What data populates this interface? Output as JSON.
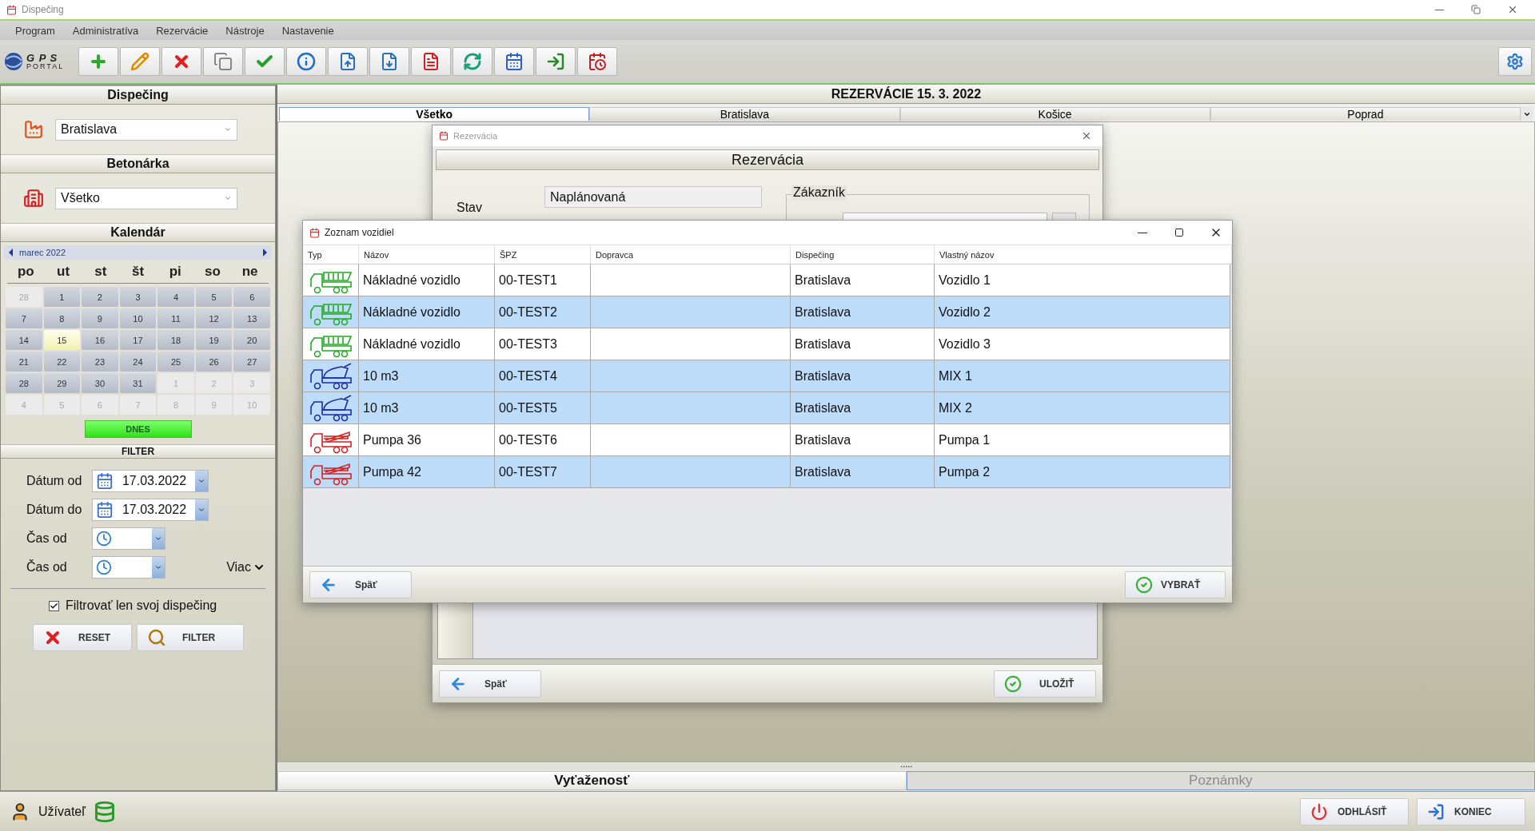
{
  "window": {
    "title": "Dispečing"
  },
  "menu": [
    "Program",
    "Administratíva",
    "Rezervácie",
    "Nástroje",
    "Nastavenie"
  ],
  "logo": {
    "top": "G P S",
    "bottom": "PORTAL"
  },
  "toolbar": [
    {
      "kind": "add"
    },
    {
      "kind": "edit"
    },
    {
      "kind": "delete"
    },
    {
      "kind": "copy"
    },
    {
      "kind": "confirm"
    },
    {
      "kind": "info"
    },
    {
      "kind": "import"
    },
    {
      "kind": "export"
    },
    {
      "kind": "pdf"
    },
    {
      "kind": "refresh"
    },
    {
      "kind": "calendar"
    },
    {
      "kind": "exit"
    },
    {
      "kind": "schedule"
    }
  ],
  "sidebar": {
    "dispatch": {
      "title": "Dispečing",
      "value": "Bratislava"
    },
    "plant": {
      "title": "Betonárka",
      "value": "Všetko"
    },
    "calendar": {
      "title": "Kalendár",
      "month": "marec 2022",
      "weekdays": [
        "po",
        "ut",
        "st",
        "št",
        "pi",
        "so",
        "ne"
      ],
      "today_button": "DNES",
      "days": [
        {
          "day": "28",
          "outside": true,
          "today": false
        },
        {
          "day": "1",
          "outside": false,
          "today": false
        },
        {
          "day": "2",
          "outside": false,
          "today": false
        },
        {
          "day": "3",
          "outside": false,
          "today": false
        },
        {
          "day": "4",
          "outside": false,
          "today": false
        },
        {
          "day": "5",
          "outside": false,
          "today": false
        },
        {
          "day": "6",
          "outside": false,
          "today": false
        },
        {
          "day": "7",
          "outside": false,
          "today": false
        },
        {
          "day": "8",
          "outside": false,
          "today": false
        },
        {
          "day": "9",
          "outside": false,
          "today": false
        },
        {
          "day": "10",
          "outside": false,
          "today": false
        },
        {
          "day": "11",
          "outside": false,
          "today": false
        },
        {
          "day": "12",
          "outside": false,
          "today": false
        },
        {
          "day": "13",
          "outside": false,
          "today": false
        },
        {
          "day": "14",
          "outside": false,
          "today": false
        },
        {
          "day": "15",
          "outside": false,
          "today": true
        },
        {
          "day": "16",
          "outside": false,
          "today": false
        },
        {
          "day": "17",
          "outside": false,
          "today": false
        },
        {
          "day": "18",
          "outside": false,
          "today": false
        },
        {
          "day": "19",
          "outside": false,
          "today": false
        },
        {
          "day": "20",
          "outside": false,
          "today": false
        },
        {
          "day": "21",
          "outside": false,
          "today": false
        },
        {
          "day": "22",
          "outside": false,
          "today": false
        },
        {
          "day": "23",
          "outside": false,
          "today": false
        },
        {
          "day": "24",
          "outside": false,
          "today": false
        },
        {
          "day": "25",
          "outside": false,
          "today": false
        },
        {
          "day": "26",
          "outside": false,
          "today": false
        },
        {
          "day": "27",
          "outside": false,
          "today": false
        },
        {
          "day": "28",
          "outside": false,
          "today": false
        },
        {
          "day": "29",
          "outside": false,
          "today": false
        },
        {
          "day": "30",
          "outside": false,
          "today": false
        },
        {
          "day": "31",
          "outside": false,
          "today": false
        },
        {
          "day": "1",
          "outside": true,
          "today": false
        },
        {
          "day": "2",
          "outside": true,
          "today": false
        },
        {
          "day": "3",
          "outside": true,
          "today": false
        },
        {
          "day": "4",
          "outside": true,
          "today": false
        },
        {
          "day": "5",
          "outside": true,
          "today": false
        },
        {
          "day": "6",
          "outside": true,
          "today": false
        },
        {
          "day": "7",
          "outside": true,
          "today": false
        },
        {
          "day": "8",
          "outside": true,
          "today": false
        },
        {
          "day": "9",
          "outside": true,
          "today": false
        },
        {
          "day": "10",
          "outside": true,
          "today": false
        }
      ]
    },
    "filter": {
      "title": "FILTER",
      "fields": [
        {
          "label": "Dátum od",
          "kind": "date",
          "value": "17.03.2022"
        },
        {
          "label": "Dátum do",
          "kind": "date",
          "value": "17.03.2022"
        },
        {
          "label": "Čas od",
          "kind": "time"
        },
        {
          "label": "Čas od",
          "kind": "time"
        }
      ],
      "more": "Viac",
      "checkbox": {
        "label": "Filtrovať len svoj dispečing",
        "checked": true
      },
      "buttons": [
        {
          "kind": "reset",
          "label": "RESET"
        },
        {
          "kind": "search",
          "label": "FILTER"
        }
      ]
    }
  },
  "main": {
    "title": "REZERVÁCIE 15. 3. 2022",
    "tabs": [
      {
        "label": "Všetko",
        "selected": true
      },
      {
        "label": "Bratislava",
        "selected": false
      },
      {
        "label": "Košice",
        "selected": false
      },
      {
        "label": "Poprad",
        "selected": false
      }
    ],
    "bottom_tabs": [
      {
        "label": "Vyťaženosť",
        "selected": true
      },
      {
        "label": "Poznámky",
        "selected": false
      }
    ]
  },
  "reservation_dialog": {
    "title": "Rezervácia",
    "header": "Rezervácia",
    "status_label": "Stav",
    "status_value": "Naplánovaná",
    "customer_group": "Zákazník",
    "buttons": [
      {
        "kind": "back",
        "label": "Späť"
      },
      {
        "kind": "ok",
        "label": "ULOŽIŤ"
      }
    ]
  },
  "vehicle_dialog": {
    "title": "Zoznam vozidiel",
    "columns": [
      "Typ",
      "Názov",
      "ŠPZ",
      "Dopravca",
      "Dispečing",
      "Vlastný názov"
    ],
    "rows": [
      {
        "kind": "dump",
        "name": "Nákladné vozidlo",
        "plate": "00-TEST1",
        "dispatch": "Bratislava",
        "custom_name": "Vozidlo 1",
        "selected": false
      },
      {
        "kind": "dump",
        "name": "Nákladné vozidlo",
        "plate": "00-TEST2",
        "dispatch": "Bratislava",
        "custom_name": "Vozidlo 2",
        "selected": true
      },
      {
        "kind": "dump",
        "name": "Nákladné vozidlo",
        "plate": "00-TEST3",
        "dispatch": "Bratislava",
        "custom_name": "Vozidlo 3",
        "selected": false
      },
      {
        "kind": "mixer",
        "name": "10 m3",
        "plate": "00-TEST4",
        "dispatch": "Bratislava",
        "custom_name": "MIX 1",
        "selected": true
      },
      {
        "kind": "mixer",
        "name": "10 m3",
        "plate": "00-TEST5",
        "dispatch": "Bratislava",
        "custom_name": "MIX 2",
        "selected": true
      },
      {
        "kind": "pump",
        "name": "Pumpa 36",
        "plate": "00-TEST6",
        "dispatch": "Bratislava",
        "custom_name": "Pumpa 1",
        "selected": false
      },
      {
        "kind": "pump",
        "name": "Pumpa 42",
        "plate": "00-TEST7",
        "dispatch": "Bratislava",
        "custom_name": "Pumpa 2",
        "selected": true
      }
    ],
    "buttons": [
      {
        "kind": "back",
        "label": "Späť"
      },
      {
        "kind": "ok",
        "label": "VYBRAŤ"
      }
    ]
  },
  "status_bar": {
    "user": "Užívateľ",
    "buttons": [
      {
        "kind": "logout",
        "label": "ODHLÁSIŤ"
      },
      {
        "kind": "exit",
        "label": "KONIEC"
      }
    ]
  }
}
